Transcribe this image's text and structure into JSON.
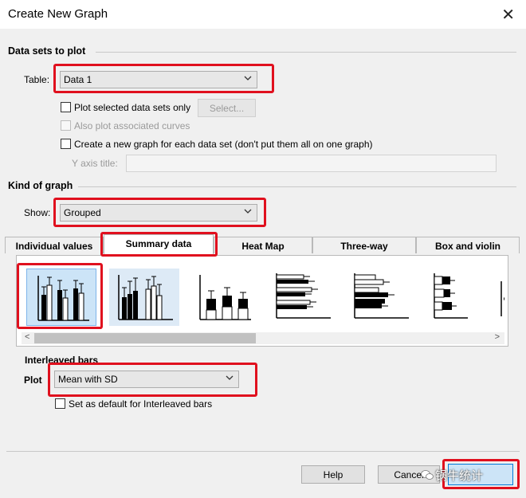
{
  "window": {
    "title": "Create New Graph"
  },
  "data_sets": {
    "heading": "Data sets to plot",
    "table_label": "Table:",
    "table_value": "Data 1",
    "plot_selected_label": "Plot selected data sets only",
    "plot_selected_checked": false,
    "select_button": "Select...",
    "also_plot_label": "Also plot associated curves",
    "new_graph_label": "Create a new graph for each data set (don't put them all on one graph)",
    "new_graph_checked": false,
    "y_axis_title_label": "Y axis title:",
    "y_axis_title_value": ""
  },
  "kind_of_graph": {
    "heading": "Kind of graph",
    "show_label": "Show:",
    "show_value": "Grouped",
    "tabs": [
      "Individual values",
      "Summary data",
      "Heat Map",
      "Three-way",
      "Box and violin"
    ],
    "active_tab": "Summary data",
    "thumbnails": [
      "interleaved-bars",
      "separated-bars",
      "stacked-bars",
      "horizontal-interleaved-bars",
      "horizontal-stacked-bars",
      "horizontal-separated-bars",
      "grouped-points"
    ],
    "selected_thumbnail": "interleaved-bars"
  },
  "options": {
    "heading": "Interleaved bars",
    "plot_label": "Plot",
    "plot_value": "Mean with SD",
    "set_default_label": "Set as default for Interleaved bars",
    "set_default_checked": false
  },
  "footer": {
    "help_button": "Help",
    "cancel_button": "Cancel",
    "watermark_text": "锅牛统计"
  },
  "colors": {
    "highlight_box": "#e0101e",
    "selection": "#cce4f7",
    "window_bg": "#f0f0f0"
  }
}
